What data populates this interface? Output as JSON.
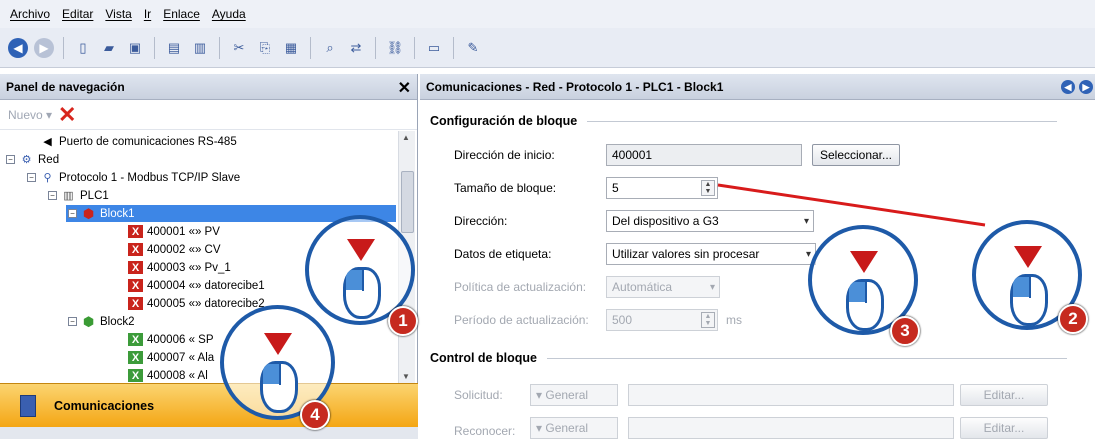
{
  "menu": [
    "Archivo",
    "Editar",
    "Vista",
    "Ir",
    "Enlace",
    "Ayuda"
  ],
  "nav": {
    "title": "Panel de navegación",
    "nuevo_label": "Nuevo",
    "tree": [
      {
        "text": "Puerto de comunicaciones RS-485",
        "icon": "port-icon"
      },
      {
        "text": "Red",
        "icon": "network-icon"
      },
      {
        "text": "Protocolo 1 - Modbus TCP/IP Slave",
        "icon": "protocol-icon"
      },
      {
        "text": "PLC1",
        "icon": "plc-icon"
      },
      {
        "text": "Block1",
        "icon": "block-red-icon"
      },
      {
        "text": "400001 «» PV",
        "icon": "tag-red-icon"
      },
      {
        "text": "400002 «» CV",
        "icon": "tag-red-icon"
      },
      {
        "text": "400003 «» Pv_1",
        "icon": "tag-red-icon"
      },
      {
        "text": "400004 «» datorecibe1",
        "icon": "tag-red-icon"
      },
      {
        "text": "400005 «» datorecibe2",
        "icon": "tag-red-icon"
      },
      {
        "text": "Block2",
        "icon": "block-green-icon"
      },
      {
        "text": "400006 « SP",
        "icon": "tag-green-icon"
      },
      {
        "text": "400007 « Ala",
        "icon": "tag-green-icon"
      },
      {
        "text": "400008 « Al",
        "icon": "tag-green-icon"
      }
    ],
    "bottom_label": "Comunicaciones"
  },
  "right": {
    "title": "Comunicaciones - Red - Protocolo 1 - PLC1 - Block1",
    "config_section": "Configuración de bloque",
    "start_label": "Dirección de inicio:",
    "start_value": "400001",
    "select_button": "Seleccionar...",
    "size_label": "Tamaño de bloque:",
    "size_value": "5",
    "direction_label": "Dirección:",
    "direction_value": "Del dispositivo a G3",
    "tagdata_label": "Datos de etiqueta:",
    "tagdata_value": "Utilizar valores sin procesar",
    "policy_label": "Política de actualización:",
    "policy_value": "Automática",
    "period_label": "Período de actualización:",
    "period_value": "500",
    "period_unit": "ms",
    "control_section": "Control de bloque",
    "request_label": "Solicitud:",
    "request_value": "General",
    "edit_label": "Editar...",
    "ack_label": "Reconocer:",
    "ack_value": "General"
  },
  "callouts": [
    "1",
    "2",
    "3",
    "4"
  ],
  "colors": {
    "selection": "#3d86e6",
    "callout_blue": "#1e5aa8",
    "badge_red": "#c62a1f",
    "nav_bar": "#f4a614"
  }
}
